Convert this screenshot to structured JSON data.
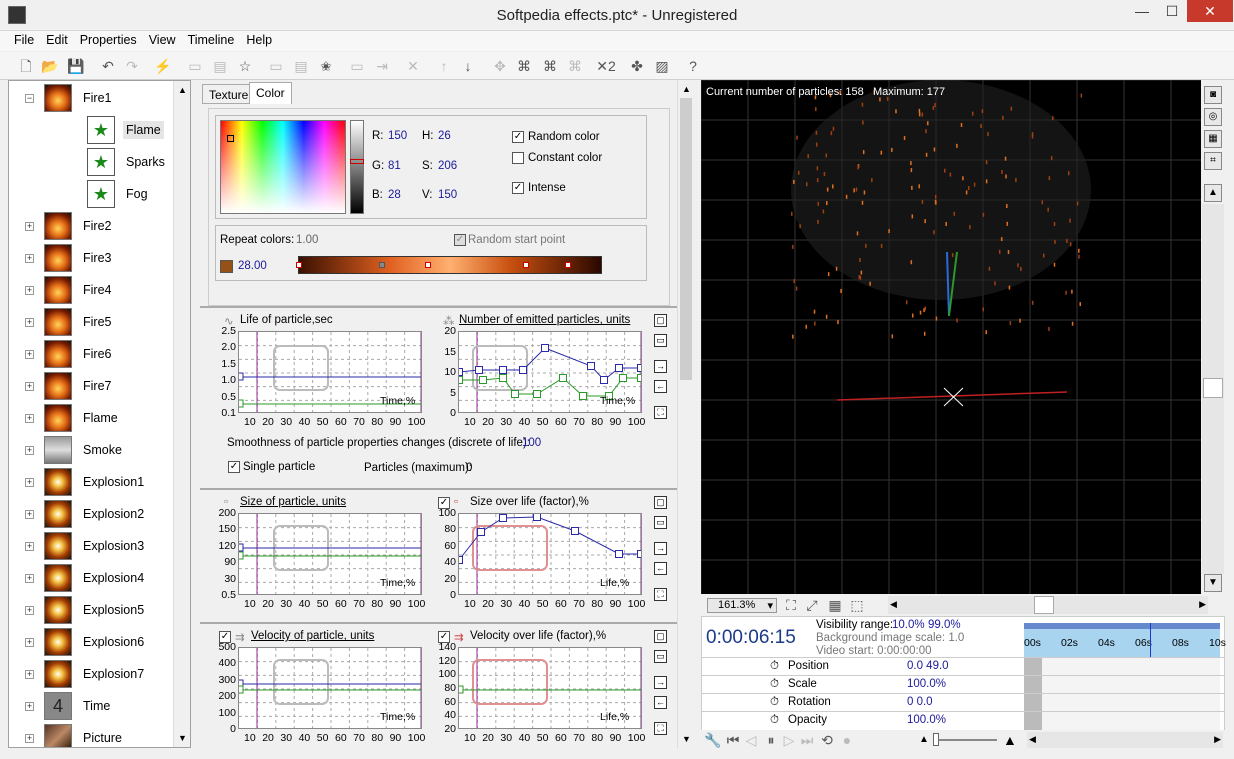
{
  "window": {
    "title": "Softpedia effects.ptc* - Unregistered",
    "minimize": "—",
    "maximize": "☐",
    "close": "✕"
  },
  "menu": [
    "File",
    "Edit",
    "Properties",
    "View",
    "Timeline",
    "Help"
  ],
  "tree": [
    {
      "label": "Fire1",
      "thumb": "fire",
      "expander": "−",
      "level": 0
    },
    {
      "label": "Flame",
      "thumb": "star",
      "level": 1,
      "selected": true
    },
    {
      "label": "Sparks",
      "thumb": "star",
      "level": 1
    },
    {
      "label": "Fog",
      "thumb": "star",
      "level": 1
    },
    {
      "label": "Fire2",
      "thumb": "fire",
      "expander": "+",
      "level": 0
    },
    {
      "label": "Fire3",
      "thumb": "fire",
      "expander": "+",
      "level": 0
    },
    {
      "label": "Fire4",
      "thumb": "fire",
      "expander": "+",
      "level": 0
    },
    {
      "label": "Fire5",
      "thumb": "fire",
      "expander": "+",
      "level": 0
    },
    {
      "label": "Fire6",
      "thumb": "fire",
      "expander": "+",
      "level": 0
    },
    {
      "label": "Fire7",
      "thumb": "fire",
      "expander": "+",
      "level": 0
    },
    {
      "label": "Flame",
      "thumb": "fire",
      "expander": "+",
      "level": 0
    },
    {
      "label": "Smoke",
      "thumb": "smoke",
      "expander": "+",
      "level": 0
    },
    {
      "label": "Explosion1",
      "thumb": "expl",
      "expander": "+",
      "level": 0
    },
    {
      "label": "Explosion2",
      "thumb": "expl",
      "expander": "+",
      "level": 0
    },
    {
      "label": "Explosion3",
      "thumb": "expl",
      "expander": "+",
      "level": 0
    },
    {
      "label": "Explosion4",
      "thumb": "expl",
      "expander": "+",
      "level": 0
    },
    {
      "label": "Explosion5",
      "thumb": "expl",
      "expander": "+",
      "level": 0
    },
    {
      "label": "Explosion6",
      "thumb": "expl",
      "expander": "+",
      "level": 0
    },
    {
      "label": "Explosion7",
      "thumb": "expl",
      "expander": "+",
      "level": 0
    },
    {
      "label": "Time",
      "thumb": "time",
      "thumbText": "4",
      "expander": "+",
      "level": 0
    },
    {
      "label": "Picture",
      "thumb": "pic",
      "expander": "+",
      "level": 0
    }
  ],
  "tabs": {
    "texture": "Texture",
    "color": "Color"
  },
  "color": {
    "r_label": "R:",
    "r": "150",
    "g_label": "G:",
    "g": "81",
    "b_label": "B:",
    "b": "28",
    "h_label": "H:",
    "h": "26",
    "s_label": "S:",
    "s": "206",
    "v_label": "V:",
    "v": "150",
    "random_color": "Random color",
    "constant_color": "Constant color",
    "intense": "Intense",
    "repeat_colors_label": "Repeat colors:",
    "repeat_colors_value": "1.00",
    "random_start_point": "Random start point",
    "swatch_value": "28.00",
    "swatch_color": "#965119"
  },
  "graphs": {
    "life": {
      "title": "Life of particle,sec",
      "yticks": [
        "2.5",
        "2.0",
        "1.5",
        "1.0",
        "0.5",
        "0.1"
      ],
      "xlabel": "Time,%"
    },
    "emitted": {
      "title": "Number of emitted particles, units",
      "yticks": [
        "20",
        "15",
        "10",
        "5",
        "0"
      ],
      "xlabel": "Time,%"
    },
    "xticks": [
      "10",
      "20",
      "30",
      "40",
      "50",
      "60",
      "70",
      "80",
      "90",
      "100"
    ],
    "smoothness_label": "Smoothness of particle properties changes (discrete of life):",
    "smoothness_value": "100",
    "single_particle": "Single particle",
    "particles_max_label": "Particles (maximum):",
    "particles_max_value": "0",
    "size": {
      "title": "Size of particle, units",
      "yticks": [
        "200",
        "150",
        "120",
        "90",
        "30",
        "0.5"
      ],
      "xlabel": "Time,%"
    },
    "size_life": {
      "title": "Size over life (factor),%",
      "yticks": [
        "100",
        "80",
        "60",
        "40",
        "20",
        "0"
      ],
      "xlabel": "Life,%"
    },
    "velocity": {
      "title": "Velocity of particle, units",
      "yticks": [
        "500",
        "400",
        "300",
        "200",
        "100",
        "0"
      ],
      "xlabel": "Time,%"
    },
    "velocity_life": {
      "title": "Velocity over life (factor),%",
      "yticks": [
        "140",
        "120",
        "100",
        "80",
        "60",
        "40",
        "20"
      ],
      "xlabel": "Life,%"
    }
  },
  "viewport": {
    "current_label": "Current number of particles:",
    "current_value": "158",
    "max_label": "Maximum:",
    "max_value": "177"
  },
  "zoom": {
    "value": "161.3%"
  },
  "timeline": {
    "time": "0:00:06:15",
    "visibility_label": "Visibility range:",
    "visibility_from": "10.0%",
    "visibility_to": "99.0%",
    "bg_scale": "Background image scale: 1.0",
    "video_start": "Video start: 0:00:00:00",
    "ruler": [
      "00s",
      "02s",
      "04s",
      "06s",
      "08s",
      "10s"
    ],
    "rows": [
      {
        "label": "Position",
        "value": "0.0   49.0"
      },
      {
        "label": "Scale",
        "value": "100.0%"
      },
      {
        "label": "Rotation",
        "value": "0   0.0"
      },
      {
        "label": "Opacity",
        "value": "100.0%"
      }
    ]
  }
}
